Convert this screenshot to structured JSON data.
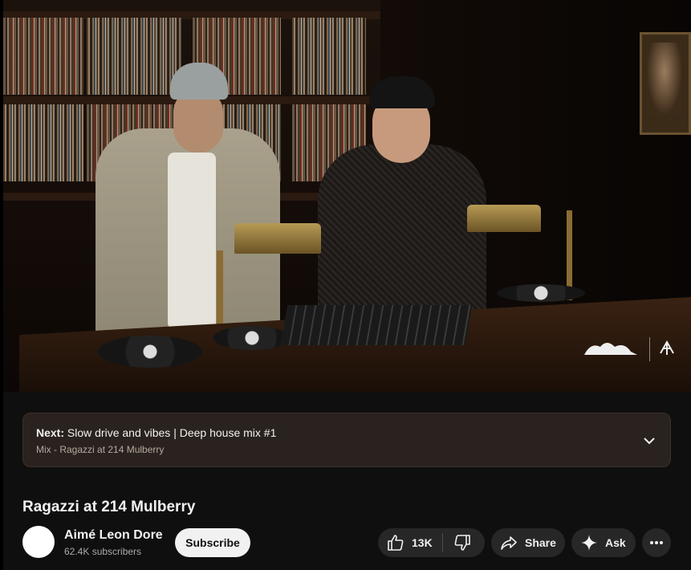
{
  "player": {
    "watermark_left": "logo-mark",
    "watermark_right": "seal-mark"
  },
  "up_next": {
    "prefix": "Next:",
    "title": "Slow drive and vibes | Deep house mix #1",
    "playlist": "Mix - Ragazzi at 214 Mulberry",
    "expand_icon": "chevron-down-icon"
  },
  "video": {
    "title": "Ragazzi at 214 Mulberry"
  },
  "channel": {
    "name": "Aimé Leon Dore",
    "subscribers": "62.4K subscribers",
    "subscribe_label": "Subscribe"
  },
  "actions": {
    "like_count": "13K",
    "like_icon": "thumbs-up-icon",
    "dislike_icon": "thumbs-down-icon",
    "share_label": "Share",
    "share_icon": "share-arrow-icon",
    "ask_label": "Ask",
    "ask_icon": "sparkle-icon",
    "more_icon": "more-dots-icon"
  },
  "colors": {
    "background": "#0f0f0f",
    "card": "#2a221e",
    "pill": "#272727",
    "subscribe_bg": "#f1f1f1"
  }
}
